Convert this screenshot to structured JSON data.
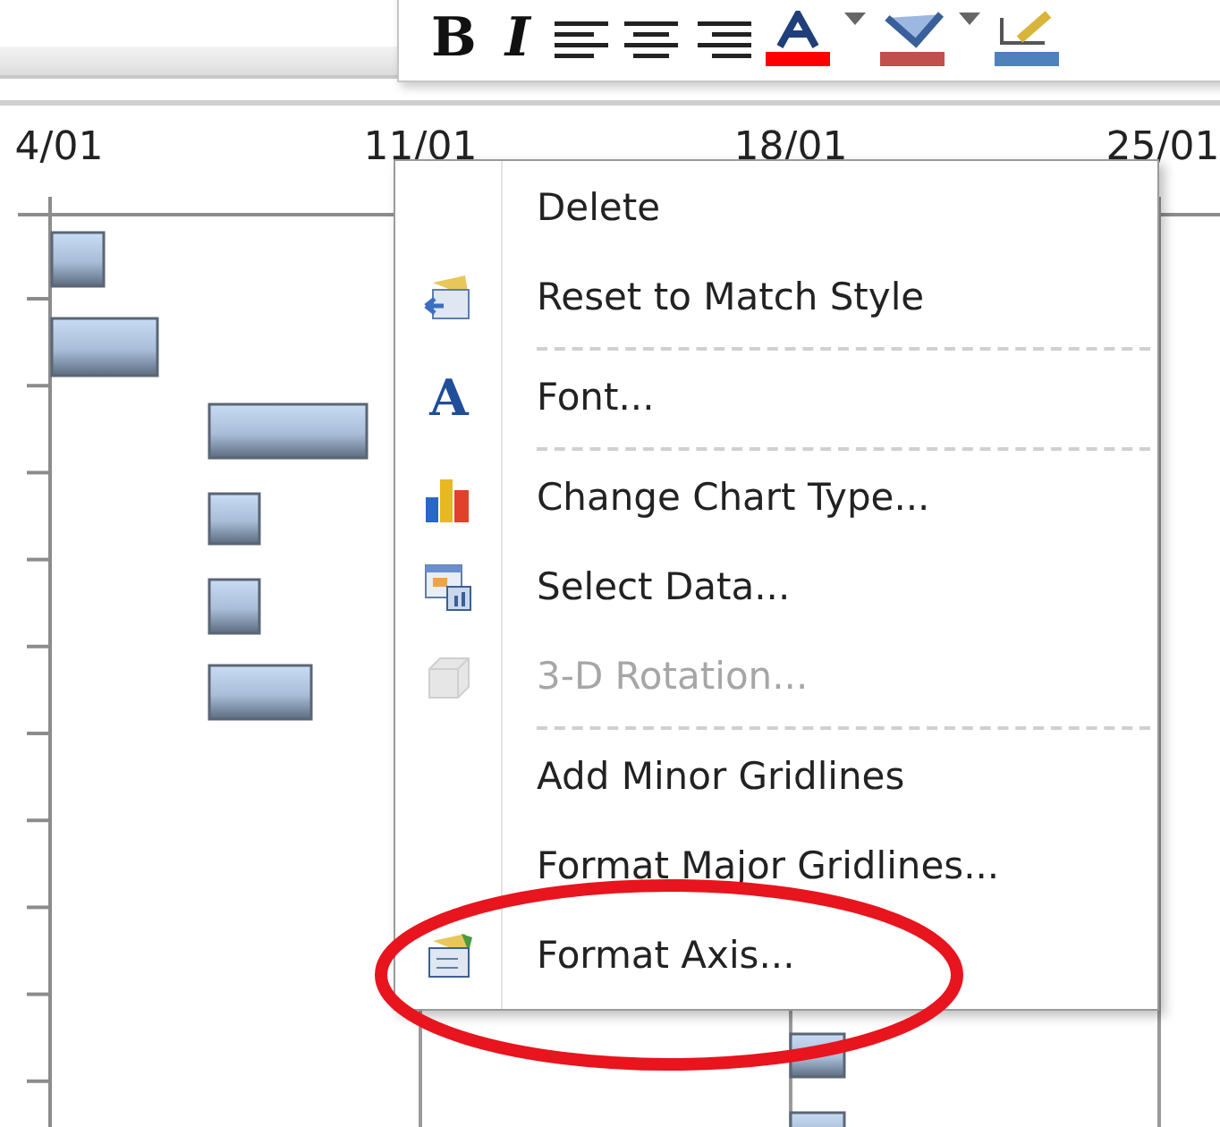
{
  "toolbar": [
    {
      "kind": "text",
      "label": "B"
    },
    {
      "kind": "text",
      "label": "I"
    },
    {
      "kind": "align-left"
    },
    {
      "kind": "align-center"
    },
    {
      "kind": "align-right"
    },
    {
      "kind": "font-color",
      "color": "#ff0000"
    },
    {
      "kind": "dropdown"
    },
    {
      "kind": "fill-color",
      "color": "#c0504d"
    },
    {
      "kind": "dropdown"
    },
    {
      "kind": "line-color",
      "color": "#4f81bd"
    }
  ],
  "chart": {
    "axis_labels": [
      "4/01",
      "11/01",
      "18/01",
      "25/01"
    ]
  },
  "context_menu": [
    {
      "kind": "item",
      "label": "Delete",
      "disabled": false,
      "highlight": false
    },
    {
      "kind": "item",
      "label": "Reset to Match Style",
      "disabled": false,
      "highlight": false
    },
    {
      "kind": "separator"
    },
    {
      "kind": "item",
      "label": "Font...",
      "glyph": "A",
      "disabled": false,
      "highlight": false
    },
    {
      "kind": "separator"
    },
    {
      "kind": "item",
      "label": "Change Chart Type...",
      "disabled": false,
      "highlight": false
    },
    {
      "kind": "item",
      "label": "Select Data...",
      "disabled": false,
      "highlight": false
    },
    {
      "kind": "item",
      "label": "3-D Rotation...",
      "disabled": true,
      "highlight": false
    },
    {
      "kind": "separator"
    },
    {
      "kind": "item",
      "label": "Add Minor Gridlines",
      "disabled": false,
      "highlight": false
    },
    {
      "kind": "item",
      "label": "Format Major Gridlines...",
      "disabled": false,
      "highlight": false
    },
    {
      "kind": "item",
      "label": "Format Axis...",
      "disabled": false,
      "highlight": true
    }
  ]
}
